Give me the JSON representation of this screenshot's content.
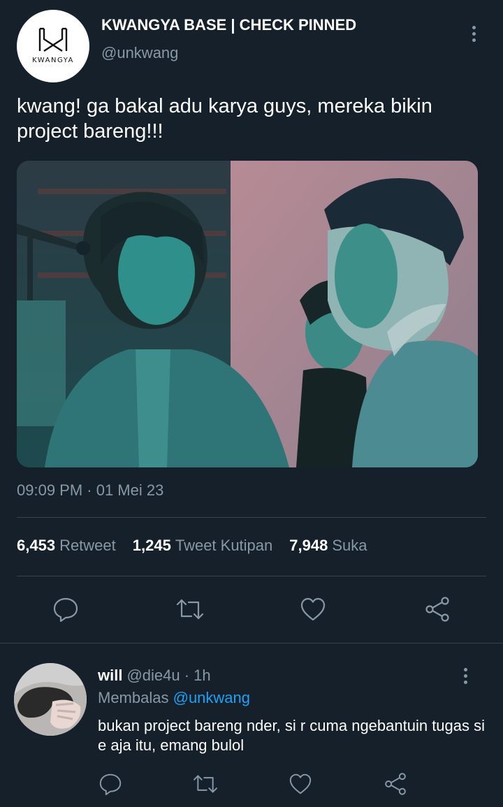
{
  "tweet": {
    "author": {
      "name": "KWANGYA BASE | CHECK PINNED",
      "handle": "@unkwang",
      "logo_text": "KWANGYA"
    },
    "text": "kwang! ga bakal adu karya guys, mereka bikin project bareng!!!",
    "media_icon": "photo",
    "timestamp": "09:09 PM · 01 Mei 23",
    "stats": {
      "retweets": "6,453",
      "retweets_label": "Retweet",
      "quotes": "1,245",
      "quotes_label": "Tweet Kutipan",
      "likes": "7,948",
      "likes_label": "Suka"
    }
  },
  "actions": [
    "reply-icon",
    "retweet-icon",
    "like-icon",
    "share-icon"
  ],
  "reply": {
    "name": "will",
    "meta": "@die4u · 1h",
    "replying_to_label": "Membalas",
    "replying_to_handle": "@unkwang",
    "text": "bukan project bareng nder, si r cuma ngebantuin tugas si e aja itu, emang bulol"
  },
  "colors": {
    "background": "#15202b",
    "secondary_text": "#8899a6",
    "link": "#1da1f2",
    "divider": "#38444d"
  }
}
